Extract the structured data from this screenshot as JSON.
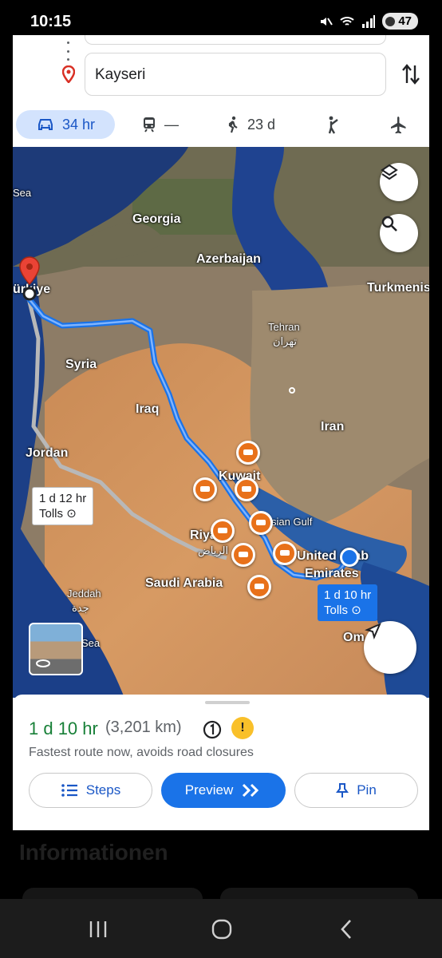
{
  "status_bar": {
    "time": "10:15",
    "battery": "47"
  },
  "search": {
    "destination": "Kayseri"
  },
  "travel_modes": [
    {
      "name": "car-icon",
      "label": "34 hr",
      "active": true
    },
    {
      "name": "transit-icon",
      "label": "—"
    },
    {
      "name": "walk-icon",
      "label": "23 d"
    },
    {
      "name": "ride-icon",
      "label": ""
    },
    {
      "name": "flight-icon",
      "label": ""
    }
  ],
  "map": {
    "labels": {
      "sea": "Sea",
      "georgia": "Georgia",
      "azerbaijan": "Azerbaijan",
      "turkmenistan": "Turkmenis",
      "turkiye": "ürkiye",
      "tehran": "Tehran",
      "tehran_native": "تهران",
      "syria": "Syria",
      "iraq": "Iraq",
      "iran": "Iran",
      "jordan": "Jordan",
      "kuwait": "Kuwait",
      "persian_gulf": "sian Gulf",
      "riyadh": "Riyadh",
      "riyadh_native": "الرياض",
      "saudi_arabia": "Saudi Arabia",
      "uae_line1": "United Arab",
      "uae_line2": "Emirates",
      "jeddah": "Jeddah",
      "jeddah_native": "جدة",
      "oman": "Om",
      "red_sea": "Sea"
    },
    "alt_route": {
      "time": "1 d 12 hr",
      "tolls": "Tolls"
    },
    "main_route": {
      "time": "1 d 10 hr",
      "tolls": "Tolls"
    }
  },
  "sheet": {
    "duration": "1 d 10 hr",
    "distance": "(3,201 km)",
    "subtitle": "Fastest route now, avoids road closures",
    "steps_label": "Steps",
    "preview_label": "Preview",
    "pin_label": "Pin"
  },
  "background_page": {
    "title": "Informationen"
  },
  "colors": {
    "accent": "#1a73e8",
    "duration": "#188038",
    "active_mode_bg": "#d3e3fd"
  }
}
